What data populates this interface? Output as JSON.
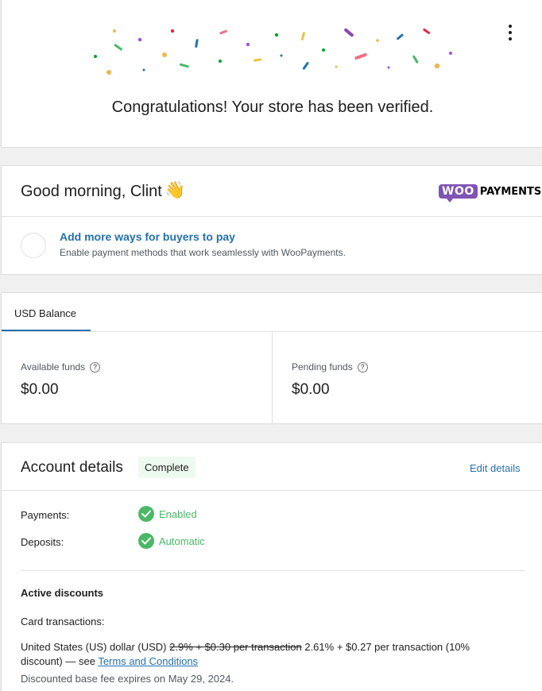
{
  "congrats": {
    "message": "Congratulations! Your store has been verified."
  },
  "greeting": {
    "title": "Good morning, Clint",
    "emoji": "👋",
    "brand_woo": "WOO",
    "brand_payments": "PAYMENTS",
    "task": {
      "title": "Add more ways for buyers to pay",
      "description": "Enable payment methods that work seamlessly with WooPayments."
    }
  },
  "balance": {
    "tab_label": "USD Balance",
    "available_label": "Available funds",
    "available_value": "$0.00",
    "pending_label": "Pending funds",
    "pending_value": "$0.00"
  },
  "account": {
    "title": "Account details",
    "badge": "Complete",
    "edit_label": "Edit details",
    "payments_label": "Payments:",
    "payments_status": "Enabled",
    "deposits_label": "Deposits:",
    "deposits_status": "Automatic",
    "discounts_title": "Active discounts",
    "card_transactions_label": "Card transactions:",
    "discount_currency": "United States (US) dollar (USD)",
    "discount_old_fee": "2.9% + $0.30 per transaction",
    "discount_new_fee": "2.61% + $0.27 per transaction (10% discount) — see",
    "terms_link": "Terms and Conditions",
    "expires_text": "Discounted base fee expires on May 29, 2024."
  },
  "colors": {
    "accent": "#2271b1",
    "success": "#4ab866",
    "brand": "#7f54b3"
  }
}
